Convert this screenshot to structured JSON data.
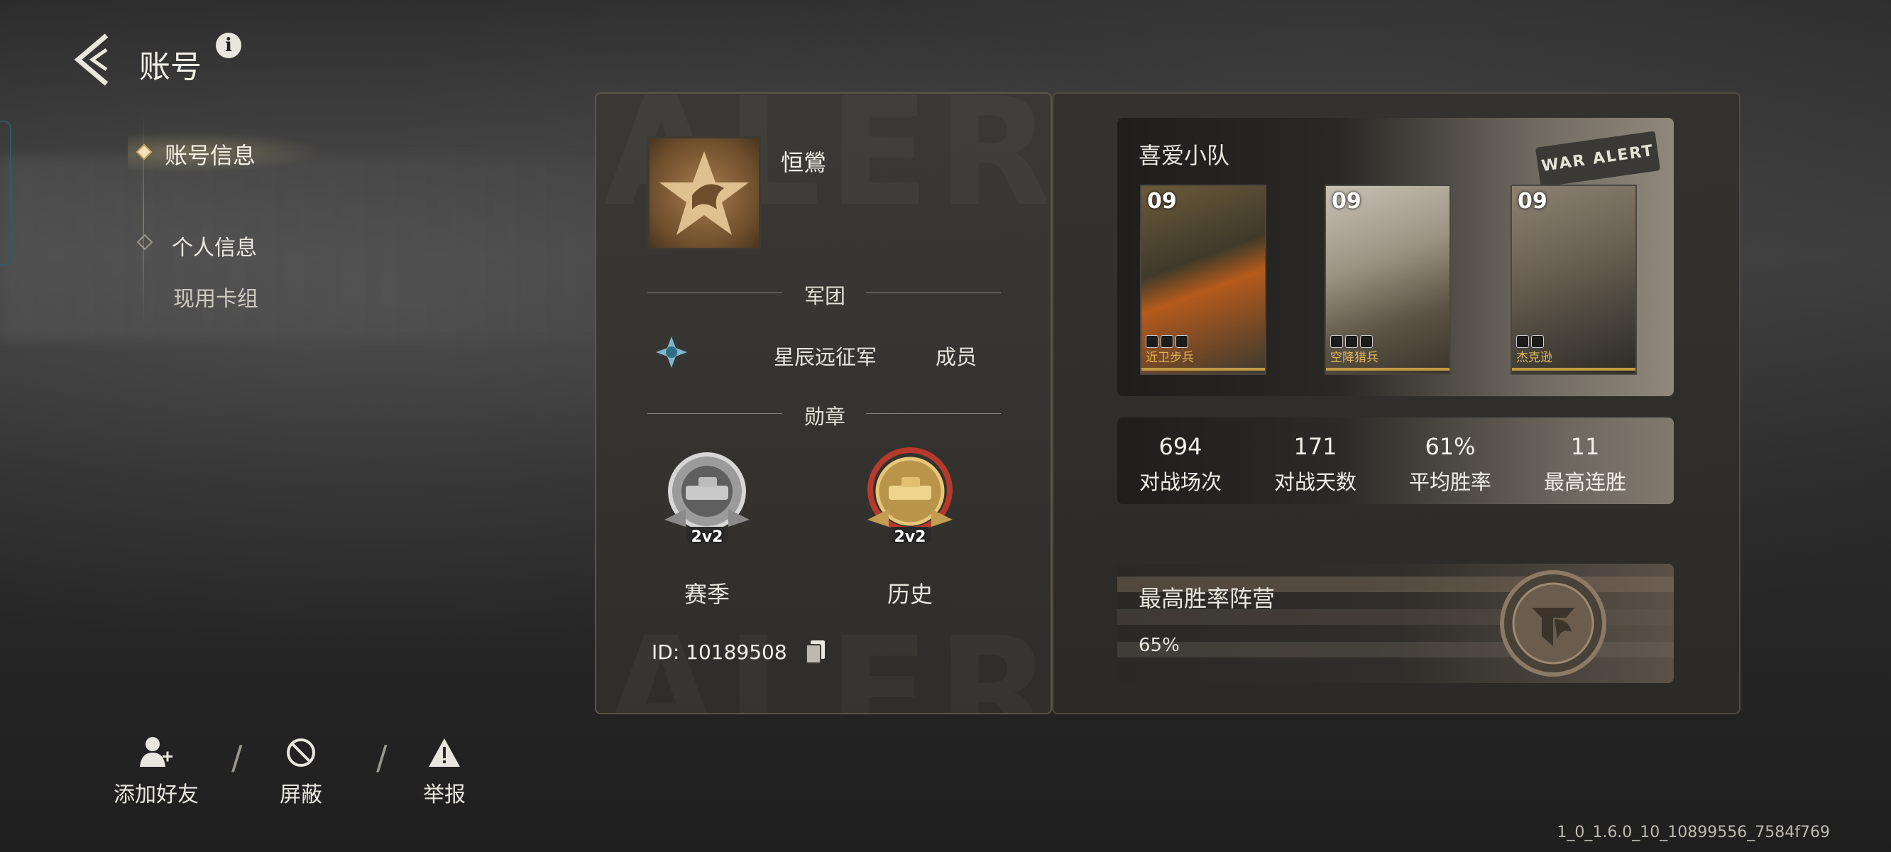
{
  "header": {
    "title": "账号"
  },
  "nav": {
    "items": [
      {
        "label": "账号信息"
      },
      {
        "label": "个人信息"
      }
    ],
    "sub_items": [
      {
        "label": "现用卡组"
      }
    ]
  },
  "actions": [
    {
      "label": "添加好友",
      "icon": "add-friend-icon"
    },
    {
      "label": "屏蔽",
      "icon": "block-icon"
    },
    {
      "label": "举报",
      "icon": "warning-icon"
    }
  ],
  "version": "1_0_1.6.0_10_10899556_7584f769",
  "profile": {
    "nickname": "恒鶯",
    "legion_section": "军团",
    "legion_name": "星辰远征军",
    "legion_role": "成员",
    "medal_section": "勋章",
    "medals": [
      {
        "mode": "2v2",
        "label": "赛季"
      },
      {
        "mode": "2v2",
        "label": "历史"
      }
    ],
    "id_text": "ID: 10189508"
  },
  "squad": {
    "title": "喜爱小队",
    "tag": "WAR ALERT",
    "cards": [
      {
        "level": "09",
        "name": "近卫步兵"
      },
      {
        "level": "09",
        "name": "空降猎兵"
      },
      {
        "level": "09",
        "name": "杰克逊"
      }
    ]
  },
  "stats": [
    {
      "value": "694",
      "label": "对战场次"
    },
    {
      "value": "171",
      "label": "对战天数"
    },
    {
      "value": "61%",
      "label": "平均胜率"
    },
    {
      "value": "11",
      "label": "最高连胜"
    }
  ],
  "best_camp": {
    "title": "最高胜率阵营",
    "value": "65%"
  }
}
